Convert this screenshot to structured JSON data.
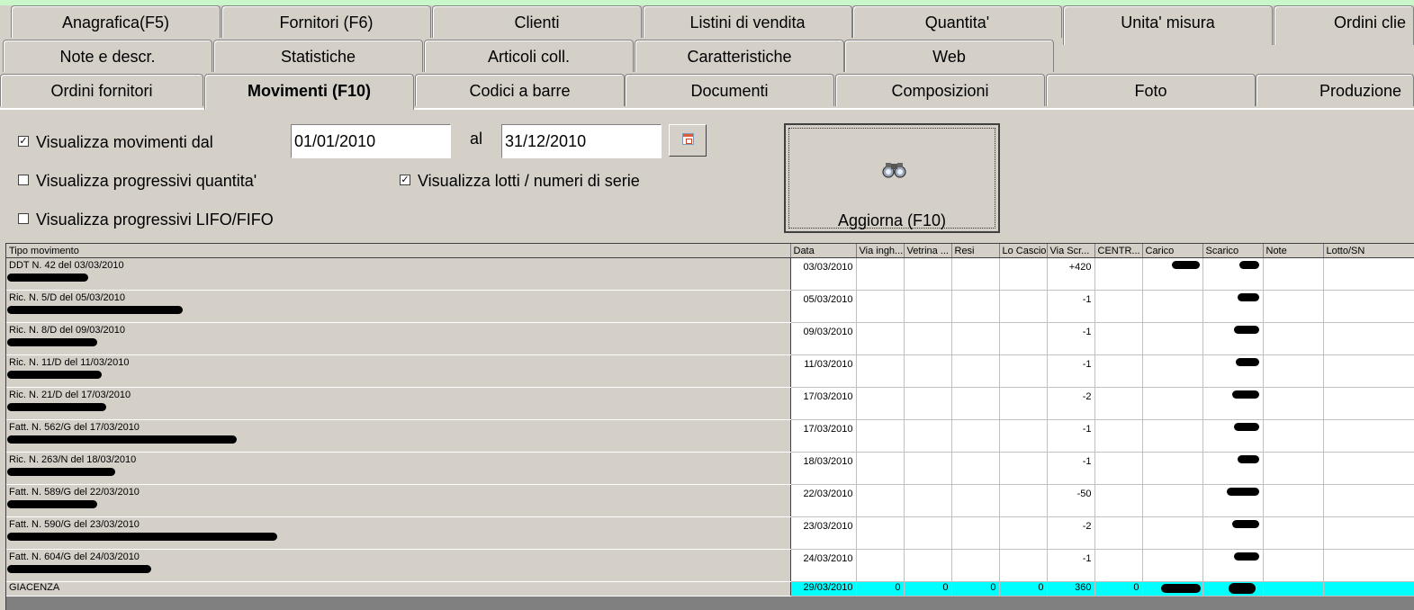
{
  "tabs": {
    "row1": [
      "Anagrafica(F5)",
      "Fornitori (F6)",
      "Clienti",
      "Listini di vendita",
      "Quantita'",
      "Unita' misura",
      "Ordini clie"
    ],
    "row2": [
      "Note e descr.",
      "Statistiche",
      "Articoli coll.",
      "Caratteristiche",
      "Web"
    ],
    "row3": [
      "Ordini fornitori",
      "Movimenti (F10)",
      "Codici a barre",
      "Documenti",
      "Composizioni",
      "Foto",
      "Produzione"
    ],
    "active": "Movimenti (F10)"
  },
  "filters": {
    "movimenti_label": "Visualizza movimenti dal",
    "movimenti_checked": true,
    "date_from": "01/01/2010",
    "al_label": "al",
    "date_to": "31/12/2010",
    "progressivi_qta_label": "Visualizza progressivi quantita'",
    "progressivi_qta_checked": false,
    "lotti_label": "Visualizza lotti /  numeri di serie",
    "lotti_checked": true,
    "lifo_label": "Visualizza progressivi LIFO/FIFO",
    "lifo_checked": false,
    "refresh_label": "Aggiorna (F10)",
    "check_mark": "✓"
  },
  "grid": {
    "columns": [
      "Tipo movimento",
      "Data",
      "Via ingh...",
      "Vetrina ...",
      "Resi",
      "Lo Cascio",
      "Via Scr...",
      "CENTR...",
      "Carico",
      "Scarico",
      "Note",
      "Lotto/SN"
    ],
    "rows": [
      {
        "tipo": "DDT N. 42 del 03/03/2010",
        "data": "03/03/2010",
        "via_scr": "+420"
      },
      {
        "tipo": "Ric. N. 5/D del 05/03/2010",
        "data": "05/03/2010",
        "via_scr": "-1"
      },
      {
        "tipo": "Ric. N. 8/D del 09/03/2010",
        "data": "09/03/2010",
        "via_scr": "-1"
      },
      {
        "tipo": "Ric. N. 11/D del 11/03/2010",
        "data": "11/03/2010",
        "via_scr": "-1"
      },
      {
        "tipo": "Ric. N. 21/D del 17/03/2010",
        "data": "17/03/2010",
        "via_scr": "-2"
      },
      {
        "tipo": "Fatt. N. 562/G del 17/03/2010",
        "data": "17/03/2010",
        "via_scr": "-1"
      },
      {
        "tipo": "Ric. N. 263/N del 18/03/2010",
        "data": "18/03/2010",
        "via_scr": "-1"
      },
      {
        "tipo": "Fatt. N. 589/G del 22/03/2010",
        "data": "22/03/2010",
        "via_scr": "-50"
      },
      {
        "tipo": "Fatt. N. 590/G del 23/03/2010",
        "data": "23/03/2010",
        "via_scr": "-2"
      },
      {
        "tipo": "Fatt. N. 604/G del 24/03/2010",
        "data": "24/03/2010",
        "via_scr": "-1"
      }
    ],
    "total": {
      "tipo": "GIACENZA",
      "data": "29/03/2010",
      "via_ingh": "0",
      "vetrina": "0",
      "resi": "0",
      "lo_cascio": "0",
      "via_scr": "360",
      "centr": "0"
    }
  },
  "colors": {
    "window_bg": "#d4d0c8",
    "total_row_bg": "#00ffff",
    "grid_empty_bg": "#808080"
  }
}
